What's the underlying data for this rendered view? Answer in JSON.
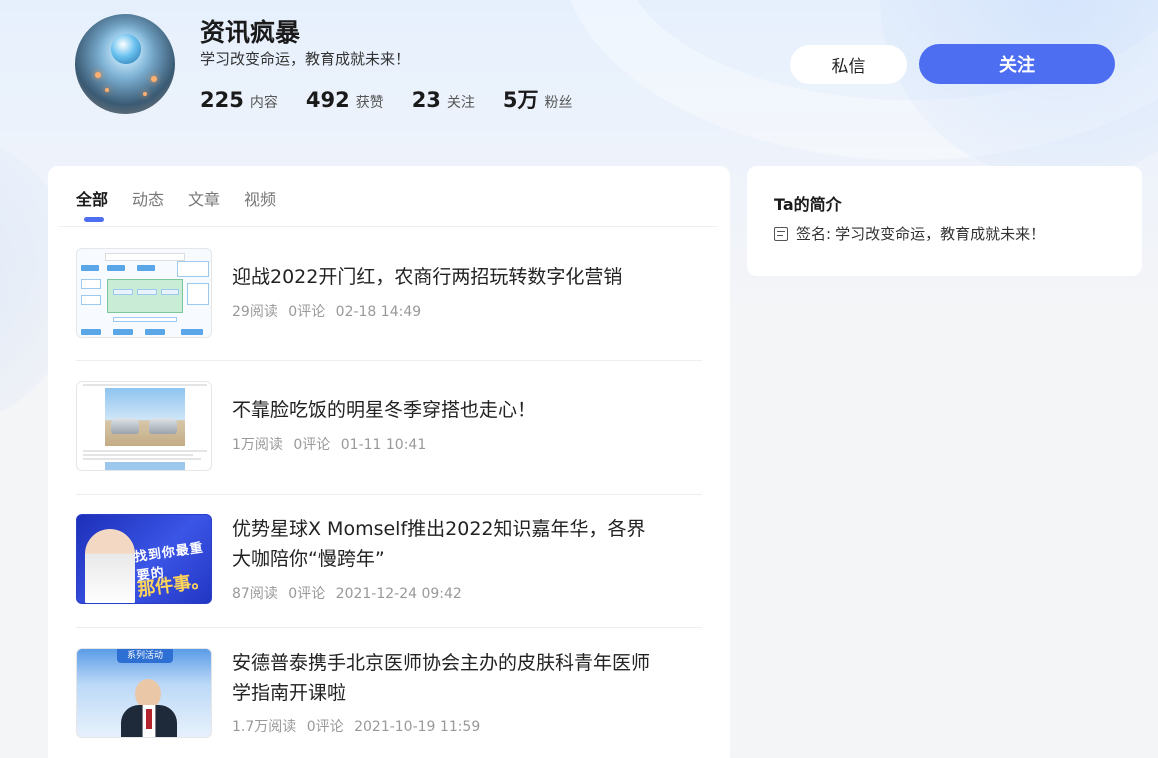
{
  "profile": {
    "name": "资讯疯暴",
    "motto": "学习改变命运，教育成就未来！",
    "stats": [
      {
        "num": "225",
        "label": "内容"
      },
      {
        "num": "492",
        "label": "获赞"
      },
      {
        "num": "23",
        "label": "关注"
      },
      {
        "num": "5万",
        "label": "粉丝"
      }
    ]
  },
  "actions": {
    "message_label": "私信",
    "follow_label": "关注"
  },
  "tabs": [
    {
      "label": "全部",
      "active": true
    },
    {
      "label": "动态",
      "active": false
    },
    {
      "label": "文章",
      "active": false
    },
    {
      "label": "视频",
      "active": false
    }
  ],
  "feed": [
    {
      "title": "迎战2022开门红，农商行两招玩转数字化营销",
      "reads": "29阅读",
      "comments": "0评论",
      "time": "02-18 14:49"
    },
    {
      "title": "不靠脸吃饭的明星冬季穿搭也走心！",
      "reads": "1万阅读",
      "comments": "0评论",
      "time": "01-11 10:41"
    },
    {
      "title": "优势星球X Momself推出2022知识嘉年华，各界大咖陪你“慢跨年”",
      "reads": "87阅读",
      "comments": "0评论",
      "time": "2021-12-24 09:42"
    },
    {
      "title": "安德普泰携手北京医师协会主办的皮肤科青年医师学指南开课啦",
      "reads": "1.7万阅读",
      "comments": "0评论",
      "time": "2021-10-19 11:59"
    }
  ],
  "thumbs": {
    "promo_big": "找到你最重要的",
    "promo_sub": "那件事。",
    "doctor_tag": "系列活动"
  },
  "side": {
    "title": "Ta的简介",
    "sign_label": "签名:",
    "sign_value": "学习改变命运，教育成就未来！"
  },
  "colors": {
    "accent": "#4e6ef2"
  }
}
